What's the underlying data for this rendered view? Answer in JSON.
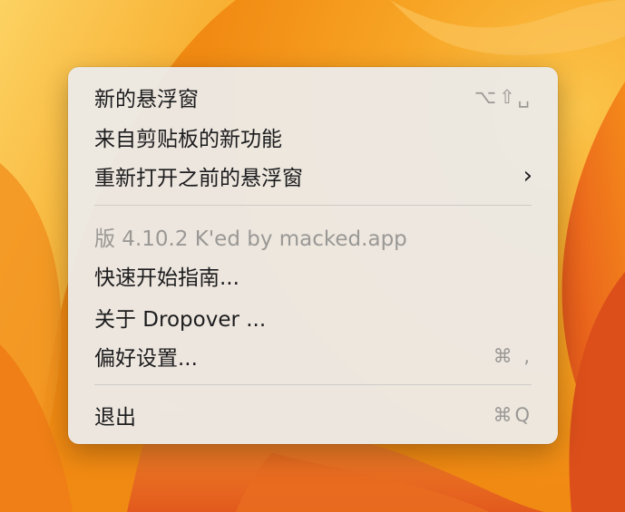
{
  "menu": {
    "items": [
      {
        "label": "新的悬浮窗",
        "shortcut": "⌥⇧␣",
        "enabled": true
      },
      {
        "label": "来自剪贴板的新功能",
        "shortcut": "",
        "enabled": true
      },
      {
        "label": "重新打开之前的悬浮窗",
        "submenu_indicator": "›",
        "enabled": true
      },
      {
        "label": "版 4.10.2 K'ed by macked.app",
        "shortcut": "",
        "enabled": false
      },
      {
        "label": "快速开始指南...",
        "shortcut": "",
        "enabled": true
      },
      {
        "label": "关于 Dropover ...",
        "shortcut": "",
        "enabled": true
      },
      {
        "label": "偏好设置...",
        "shortcut": "⌘ ,",
        "enabled": true
      },
      {
        "label": "退出",
        "shortcut": "⌘Q",
        "enabled": true
      }
    ]
  },
  "colors": {
    "menu_background": "#ece9e5",
    "text": "#1c1c1e",
    "disabled_text": "#9a9895",
    "wallpaper_orange": "#f6a21e",
    "wallpaper_red": "#e0521c"
  },
  "icons": {
    "submenu": "chevron-right-icon",
    "wallpaper": "macos-ventura-wallpaper"
  }
}
